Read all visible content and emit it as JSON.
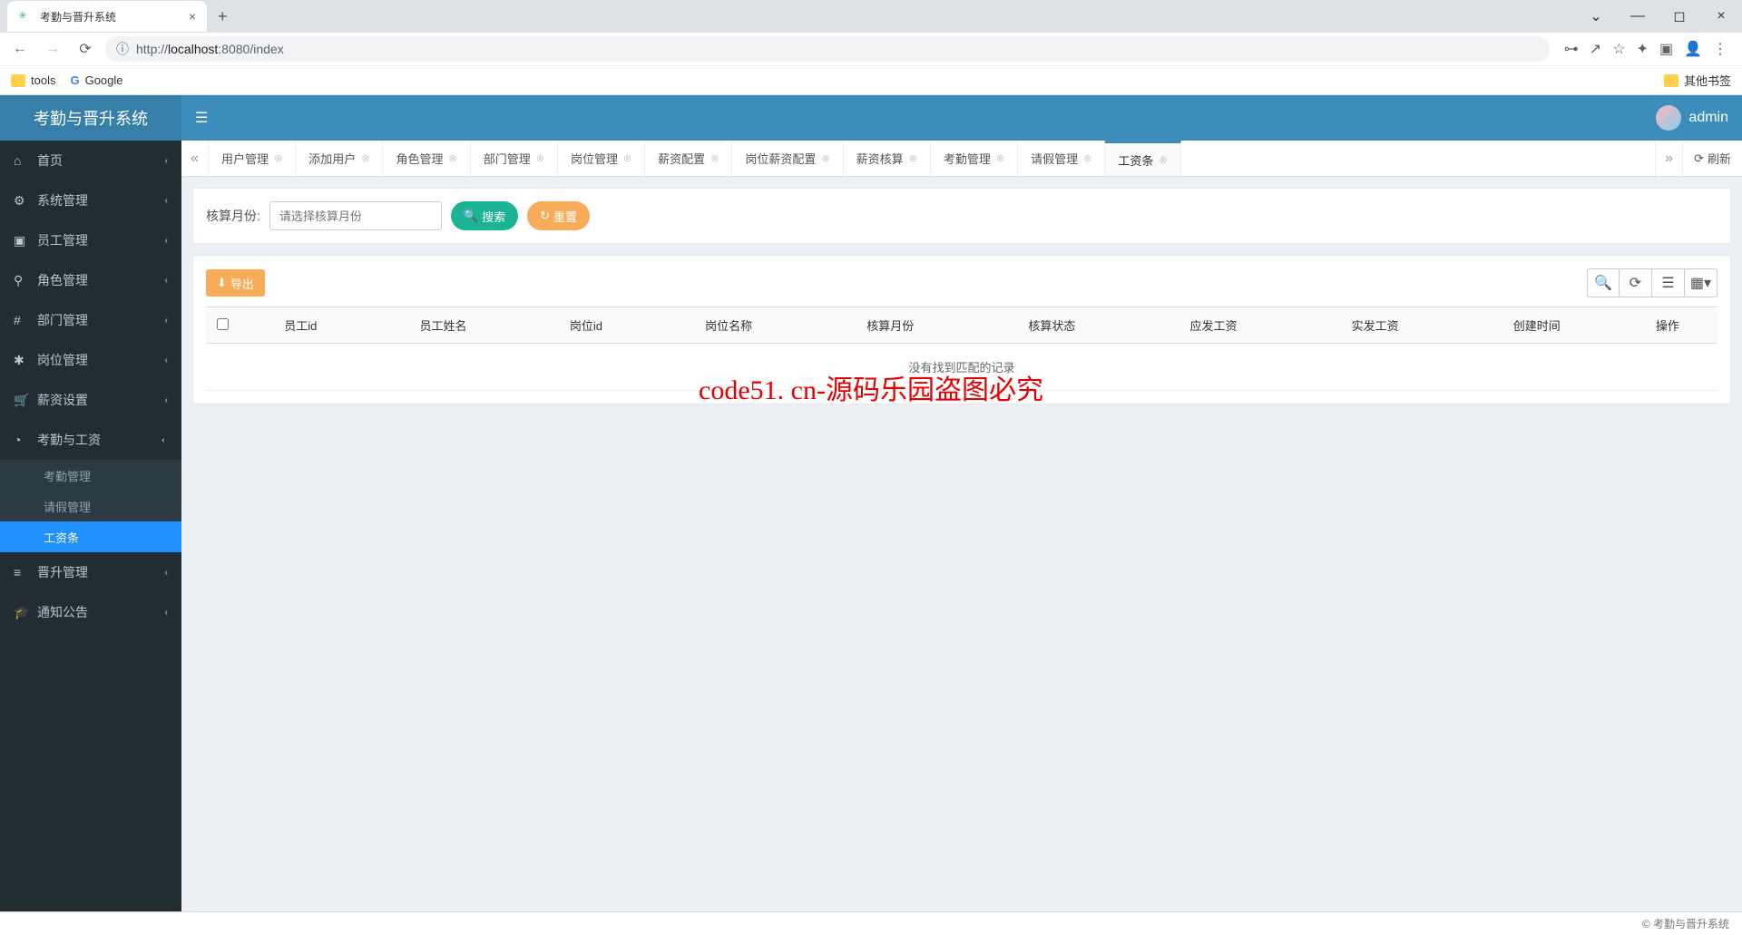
{
  "browser": {
    "tab_title": "考勤与晋升系统",
    "url_host": "localhost",
    "url_port": ":8080",
    "url_path": "/index",
    "url_prefix": "http://",
    "bookmarks": {
      "tools": "tools",
      "google": "Google",
      "other": "其他书签"
    }
  },
  "app": {
    "title": "考勤与晋升系统",
    "user": "admin",
    "footer": "© 考勤与晋升系统"
  },
  "sidebar": [
    {
      "icon": "home",
      "label": "首页",
      "children": null
    },
    {
      "icon": "gear",
      "label": "系统管理",
      "children": null
    },
    {
      "icon": "id",
      "label": "员工管理",
      "children": null
    },
    {
      "icon": "role",
      "label": "角色管理",
      "children": null
    },
    {
      "icon": "hash",
      "label": "部门管理",
      "children": null
    },
    {
      "icon": "star",
      "label": "岗位管理",
      "children": null
    },
    {
      "icon": "cart",
      "label": "薪资设置",
      "children": null
    },
    {
      "icon": "clock",
      "label": "考勤与工资",
      "expanded": true,
      "children": [
        {
          "label": "考勤管理"
        },
        {
          "label": "请假管理"
        },
        {
          "label": "工资条",
          "active": true
        }
      ]
    },
    {
      "icon": "bars",
      "label": "晋升管理",
      "children": null
    },
    {
      "icon": "grad",
      "label": "通知公告",
      "children": null
    }
  ],
  "tabs": [
    {
      "label": "用户管理"
    },
    {
      "label": "添加用户"
    },
    {
      "label": "角色管理"
    },
    {
      "label": "部门管理"
    },
    {
      "label": "岗位管理"
    },
    {
      "label": "薪资配置"
    },
    {
      "label": "岗位薪资配置"
    },
    {
      "label": "薪资核算"
    },
    {
      "label": "考勤管理"
    },
    {
      "label": "请假管理"
    },
    {
      "label": "工资条",
      "active": true
    }
  ],
  "tab_refresh": "刷新",
  "filter": {
    "label": "核算月份:",
    "placeholder": "请选择核算月份",
    "search": "搜索",
    "reset": "重置"
  },
  "toolbar": {
    "export": "导出"
  },
  "table": {
    "columns": [
      "员工id",
      "员工姓名",
      "岗位id",
      "岗位名称",
      "核算月份",
      "核算状态",
      "应发工资",
      "实发工资",
      "创建时间",
      "操作"
    ],
    "no_records": "没有找到匹配的记录"
  },
  "watermark_main": "code51. cn-源码乐园盗图必究"
}
